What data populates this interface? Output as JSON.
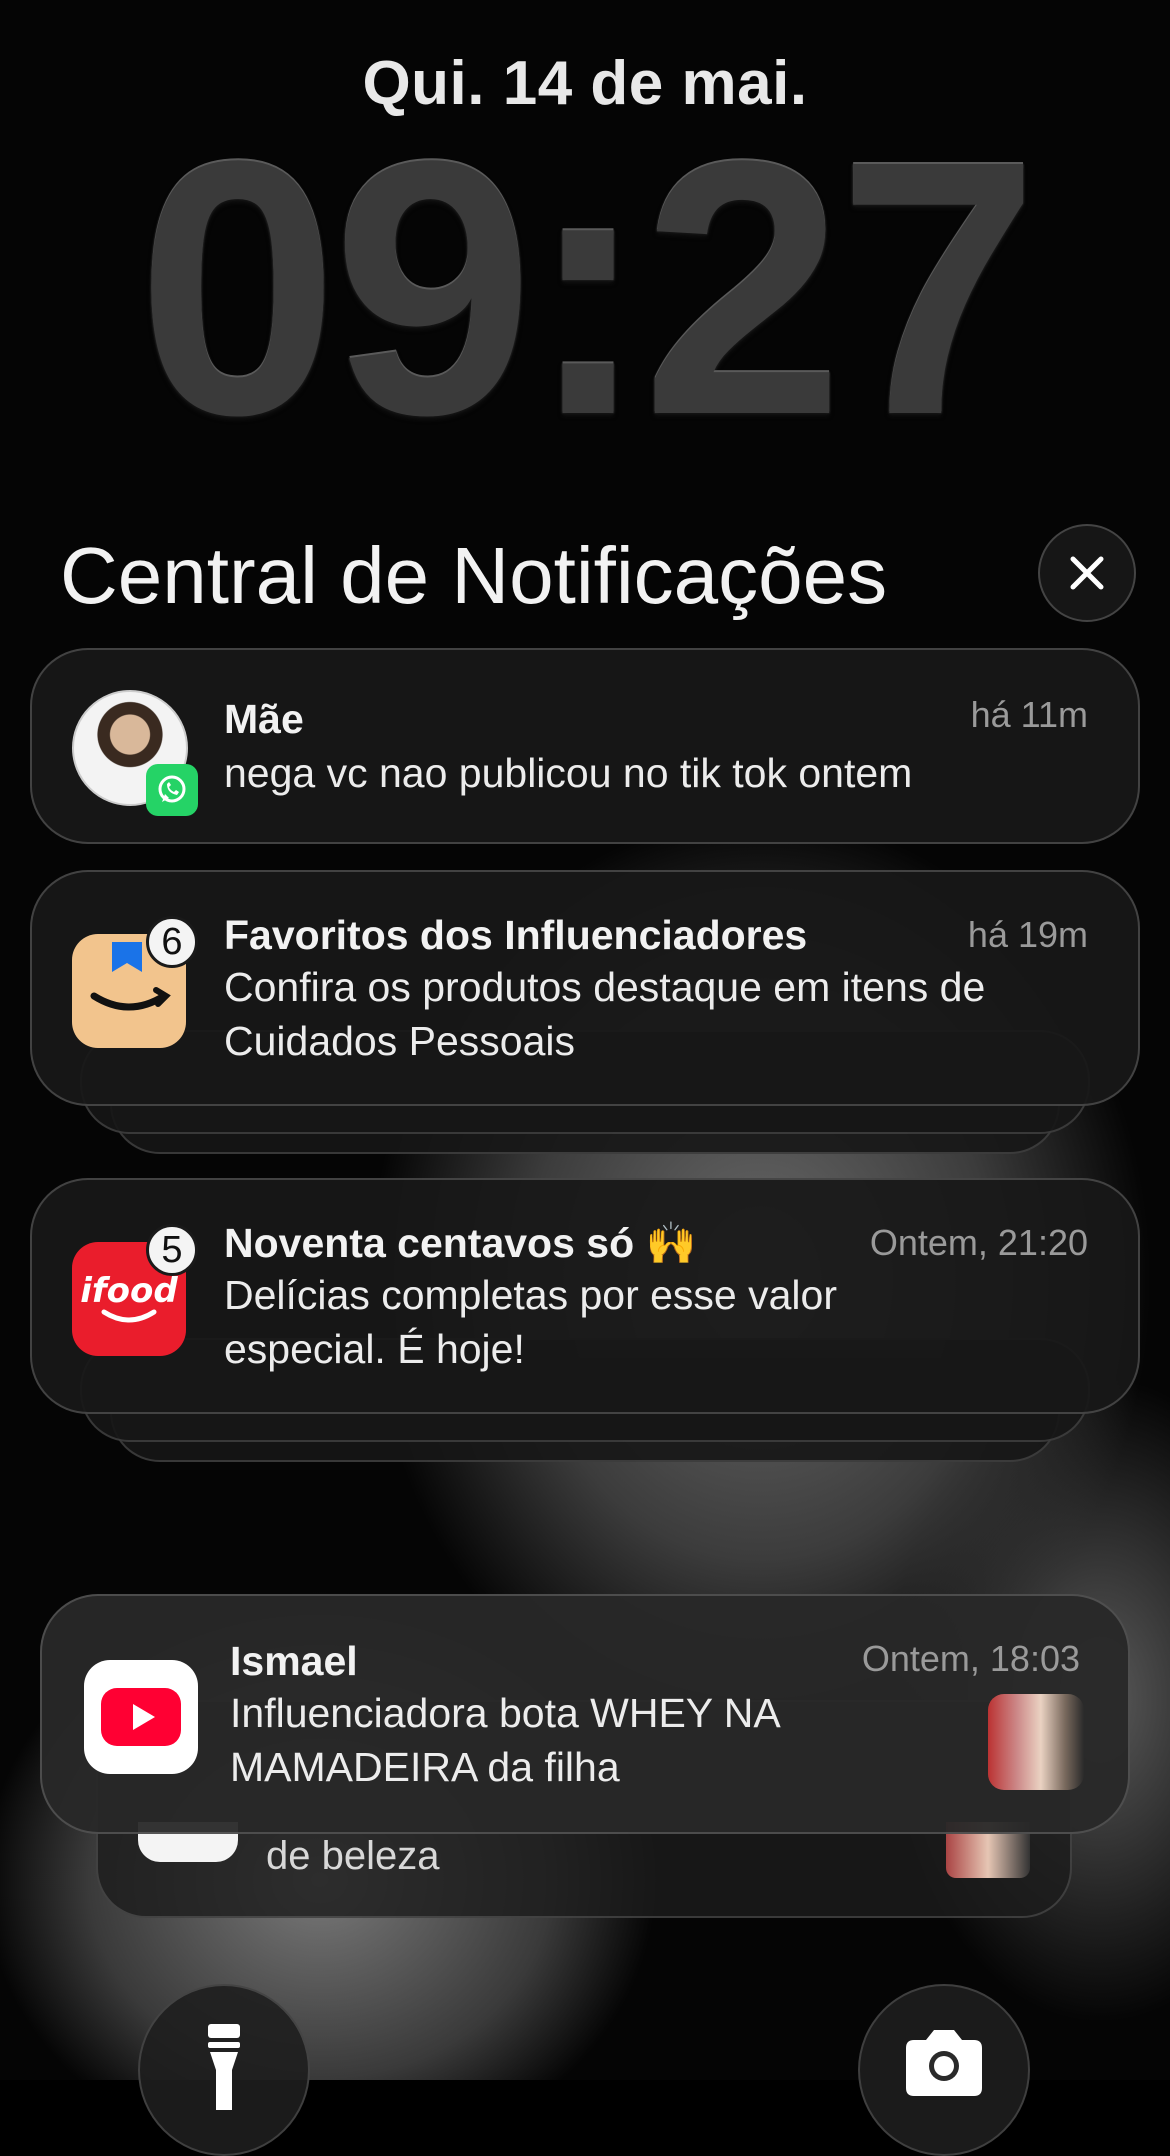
{
  "lockscreen": {
    "date": "Qui. 14 de mai.",
    "time": "09:27"
  },
  "notification_center": {
    "title": "Central de Notificações",
    "close_icon": "close-icon"
  },
  "notifications": [
    {
      "app": "WhatsApp",
      "icon": "whatsapp-contact-avatar",
      "title": "Mãe",
      "time": "há 11m",
      "body": "nega vc nao publicou no tik tok ontem"
    },
    {
      "app": "Amazon",
      "icon": "amazon-icon",
      "badge": "6",
      "title": "Favoritos dos Influenciadores",
      "time": "há 19m",
      "body": "Confira os produtos destaque em itens de Cuidados Pessoais"
    },
    {
      "app": "iFood",
      "icon": "ifood-icon",
      "badge": "5",
      "title": "Noventa centavos só 🙌",
      "time": "Ontem, 21:20",
      "body": "Delícias completas por esse valor especial. É hoje!"
    },
    {
      "app": "YouTube",
      "icon": "youtube-icon",
      "title": "Ismael",
      "time": "Ontem, 18:03",
      "body": "Influenciadora bota WHEY NA MAMADEIRA da filha"
    }
  ],
  "stacked_hint": {
    "body": "de beleza"
  },
  "quick_actions": {
    "flashlight": "flashlight-icon",
    "camera": "camera-icon"
  },
  "colors": {
    "whatsapp_green": "#25D366",
    "amazon_bg": "#F2C48D",
    "ifood_red": "#EA1D2C",
    "youtube_red": "#FF0033"
  }
}
